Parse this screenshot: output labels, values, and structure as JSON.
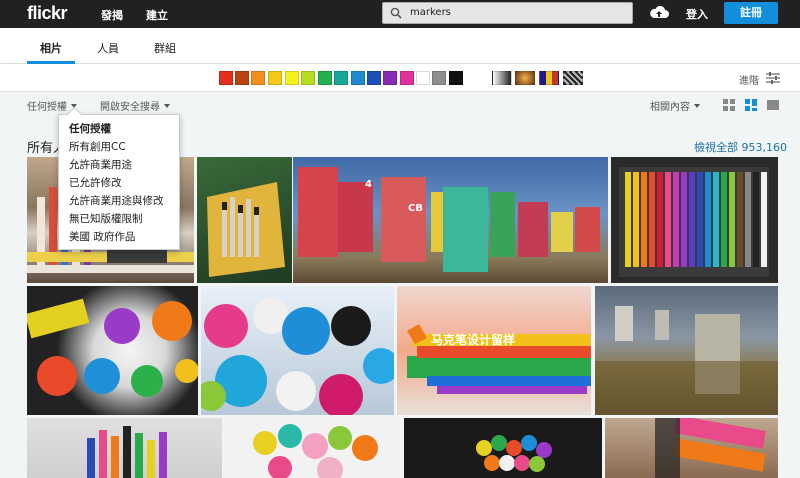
{
  "header": {
    "logo": "flickr",
    "nav": [
      "發揭",
      "建立"
    ],
    "search_value": "markers",
    "login": "登入",
    "signup": "註冊"
  },
  "tabs": [
    "相片",
    "人員",
    "群組"
  ],
  "colors": {
    "swatches": [
      "#e52e1c",
      "#b84412",
      "#f28f1c",
      "#f5c918",
      "#f7f01f",
      "#b5dc1f",
      "#22b14c",
      "#1aa699",
      "#1e8bd1",
      "#1e4fb8",
      "#8a2bb8",
      "#e0329b",
      "#ffffff",
      "#8e8e8e",
      "#111111"
    ],
    "accent": "#128fdc",
    "header_bg": "#212124"
  },
  "style_swatches": [
    "black-white",
    "shallow-depth",
    "minimalist",
    "pattern"
  ],
  "advanced": "進階",
  "filters": {
    "license": "任何授權",
    "safe_search": "開啟安全搜尋",
    "sort": "相關內容"
  },
  "results": {
    "heading": "所有人",
    "view_all": "檢視全部 953,160"
  },
  "license_menu": [
    "任何授權",
    "所有創用CC",
    "允許商業用途",
    "已允許修改",
    "允許商業用途與修改",
    "無已知版權限制",
    "美國 政府作品"
  ],
  "photo_overlay_text": "马克笔设计留样"
}
